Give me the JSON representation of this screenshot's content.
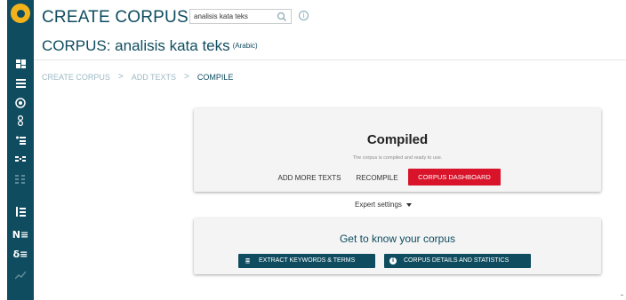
{
  "app": {
    "title": "CREATE CORPUS"
  },
  "search": {
    "value": "analisis kata teks"
  },
  "corpus": {
    "title": "CORPUS: analisis kata teks",
    "language": "(Arabic)"
  },
  "breadcrumb": [
    {
      "label": "CREATE CORPUS"
    },
    {
      "label": "ADD TEXTS"
    },
    {
      "label": "COMPILE"
    }
  ],
  "breadcrumb_sep": ">",
  "compiled_card": {
    "heading": "Compiled",
    "subtext": "The corpus is compiled and ready to use.",
    "add_more_label": "ADD MORE TEXTS",
    "recompile_label": "RECOMPILE",
    "dashboard_label": "CORPUS DASHBOARD"
  },
  "expert_settings": {
    "label": "Expert settings"
  },
  "know_card": {
    "heading": "Get to know your corpus",
    "keywords_label": "EXTRACT KEYWORDS & TERMS",
    "details_label": "CORPUS DETAILS AND STATISTICS"
  },
  "sidebar": {
    "icons": [
      "dashboard-icon",
      "list-icon",
      "target-icon",
      "link-icon",
      "bullet-list-icon",
      "parallel-icon",
      "grid-icon",
      "sort-icon",
      "numbered-list-icon",
      "language-list-icon",
      "trend-icon"
    ]
  },
  "colors": {
    "brand": "#0f4c5f",
    "accent_red": "#d8132a",
    "logo": "#f2b21b"
  }
}
